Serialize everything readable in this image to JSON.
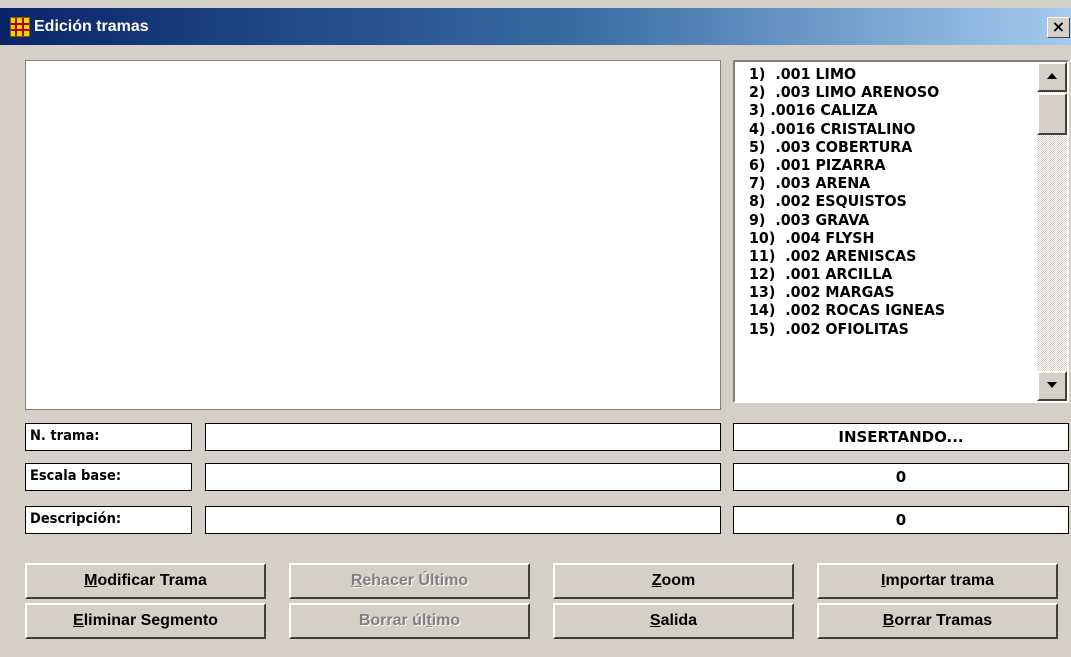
{
  "window": {
    "title": "Edición tramas",
    "close_glyph": "×",
    "icon": "app-grid-icon"
  },
  "pattern_list": {
    "items": [
      "1)  .001 LIMO",
      "2)  .003 LIMO ARENOSO",
      "3) .0016 CALIZA",
      "4) .0016 CRISTALINO",
      "5)  .003 COBERTURA",
      "6)  .001 PIZARRA",
      "7)  .003 ARENA",
      "8)  .002 ESQUISTOS",
      "9)  .003 GRAVA",
      "10)  .004 FLYSH",
      "11)  .002 ARENISCAS",
      "12)  .001 ARCILLA",
      "13)  .002 MARGAS",
      "14)  .002 ROCAS IGNEAS",
      "15)  .002 OFIOLITAS"
    ],
    "scroll_position": 0
  },
  "fields": {
    "n_trama": {
      "label": "N. trama:",
      "value": ""
    },
    "escala_base": {
      "label": "Escala base:",
      "value": ""
    },
    "descripcion": {
      "label": "Descripción:",
      "value": ""
    }
  },
  "status": {
    "mode": "INSERTANDO...",
    "value1": "0",
    "value2": "0"
  },
  "buttons": {
    "modificar": {
      "label": "Modificar Trama",
      "mnemonic": "M",
      "enabled": true
    },
    "rehacer": {
      "label": "Rehacer Último",
      "mnemonic": "R",
      "enabled": false
    },
    "zoom": {
      "label": "Zoom",
      "mnemonic": "Z",
      "enabled": true
    },
    "importar": {
      "label": "Importar trama",
      "mnemonic": "I",
      "enabled": true
    },
    "eliminar": {
      "label": "Eliminar Segmento",
      "mnemonic": "E",
      "enabled": true
    },
    "borrar_ultimo": {
      "label": "Borrar último",
      "mnemonic": "t",
      "enabled": false
    },
    "salida": {
      "label": "Salida",
      "mnemonic": "S",
      "enabled": true
    },
    "borrar_tramas": {
      "label": "Borrar Tramas",
      "mnemonic": "B",
      "enabled": true
    }
  },
  "colors": {
    "titlebar_start": "#0a246a",
    "titlebar_end": "#a6caf0",
    "face": "#d4d0c8"
  }
}
